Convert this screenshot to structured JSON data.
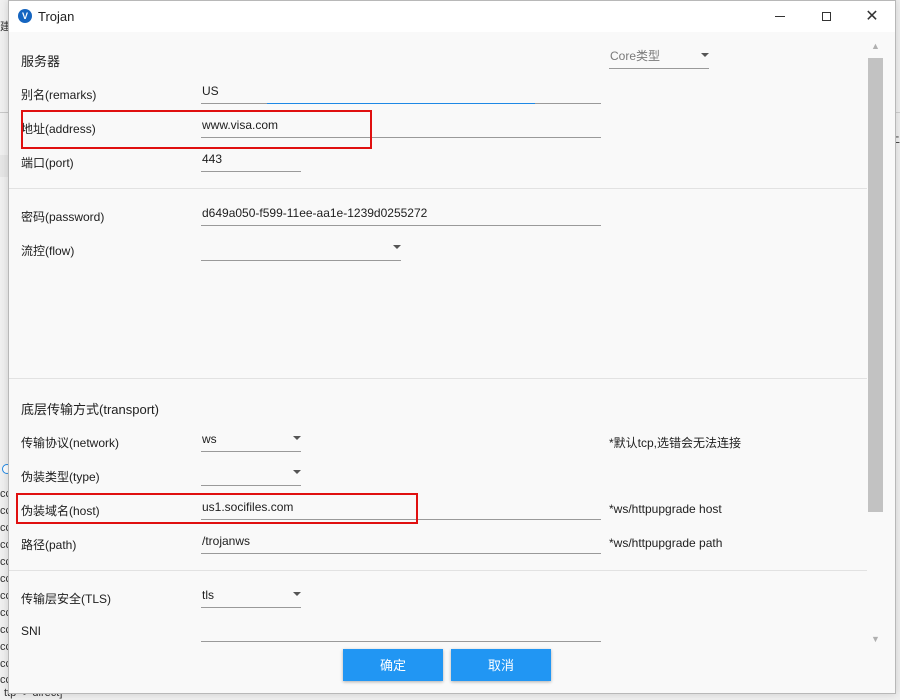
{
  "window": {
    "title": "Trojan"
  },
  "background": {
    "top_fragment": "建",
    "right_fragment": "上",
    "right_fragment_2": "3",
    "left_rows": [
      "cc",
      "cc",
      "cc",
      "cc",
      "cc",
      "cc",
      "cc",
      "cc",
      "cc",
      "cc",
      "cc",
      "cc"
    ],
    "bottom_fragment": "ttp -> direct]"
  },
  "server": {
    "section_title": "服务器",
    "core_type": {
      "value": "Core类型"
    },
    "remarks": {
      "label": "别名(remarks)",
      "value": "US"
    },
    "address": {
      "label": "地址(address)",
      "value": "www.visa.com"
    },
    "port": {
      "label": "端口(port)",
      "value": "443"
    }
  },
  "auth": {
    "password": {
      "label": "密码(password)",
      "value": "d649a050-f599-11ee-aa1e-1239d0255272"
    },
    "flow": {
      "label": "流控(flow)",
      "value": ""
    }
  },
  "transport": {
    "section_title": "底层传输方式(transport)",
    "network": {
      "label": "传输协议(network)",
      "value": "ws",
      "note": "*默认tcp,选错会无法连接"
    },
    "type": {
      "label": "伪装类型(type)",
      "value": ""
    },
    "host": {
      "label": "伪装域名(host)",
      "value": "us1.socifiles.com",
      "note": "*ws/httpupgrade host"
    },
    "path": {
      "label": "路径(path)",
      "value": "/trojanws",
      "note": "*ws/httpupgrade path"
    }
  },
  "tls": {
    "security": {
      "label": "传输层安全(TLS)",
      "value": "tls"
    },
    "sni": {
      "label": "SNI",
      "value": ""
    }
  },
  "buttons": {
    "confirm": "确定",
    "cancel": "取消"
  },
  "colors": {
    "accent": "#2196f3",
    "highlight": "#e01010",
    "focus_underline": "#1e88e5"
  }
}
